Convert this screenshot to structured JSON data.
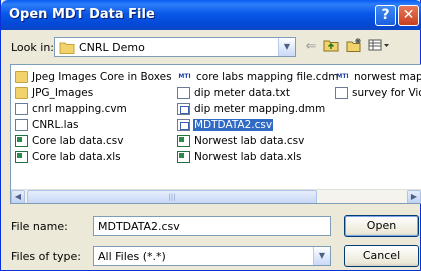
{
  "window": {
    "title": "Open MDT Data File",
    "help_label": "?",
    "close_label": "✕"
  },
  "toolbar": {
    "look_in_label": "Look in:",
    "look_in_value": "CNRL Demo",
    "dropdown_arrow": "▼",
    "back_icon": "⇐",
    "up_icon": "⬆",
    "new_folder_icon": "✱",
    "view_icon": "☰▾"
  },
  "files": [
    {
      "name": "Jpeg Images Core in Boxes",
      "icon": "folder-icon",
      "selected": false
    },
    {
      "name": "JPG_Images",
      "icon": "folder-icon",
      "selected": false
    },
    {
      "name": "cnrl mapping.cvm",
      "icon": "doc-icon",
      "selected": false
    },
    {
      "name": "CNRL.las",
      "icon": "doc-icon",
      "selected": false
    },
    {
      "name": "Core lab data.csv",
      "icon": "excel-icon",
      "selected": false
    },
    {
      "name": "Core lab data.xls",
      "icon": "excel-icon",
      "selected": false
    },
    {
      "name": "core labs mapping file.cdm",
      "icon": "mti-icon",
      "selected": false
    },
    {
      "name": "dip meter data.txt",
      "icon": "text-file-icon",
      "selected": false
    },
    {
      "name": "dip meter mapping.dmm",
      "icon": "dmm-icon",
      "selected": false
    },
    {
      "name": "MDTDATA2.csv",
      "icon": "mdt-icon",
      "selected": true
    },
    {
      "name": "Norwest lab data.csv",
      "icon": "excel-icon",
      "selected": false
    },
    {
      "name": "Norwest lab data.xls",
      "icon": "excel-icon",
      "selected": false
    },
    {
      "name": "norwest mappi",
      "icon": "mti-icon",
      "selected": false
    },
    {
      "name": "survey for Vict",
      "icon": "text-file-icon",
      "selected": false
    }
  ],
  "mti_label": "MTI",
  "scrollbar": {
    "left_arrow": "◀",
    "right_arrow": "▶",
    "thumb_grip": "|||"
  },
  "filename": {
    "label": "File name:",
    "value": "MDTDATA2.csv"
  },
  "filetype": {
    "label": "Files of type:",
    "value": "All Files (*.*)"
  },
  "buttons": {
    "open": "Open",
    "cancel": "Cancel"
  }
}
